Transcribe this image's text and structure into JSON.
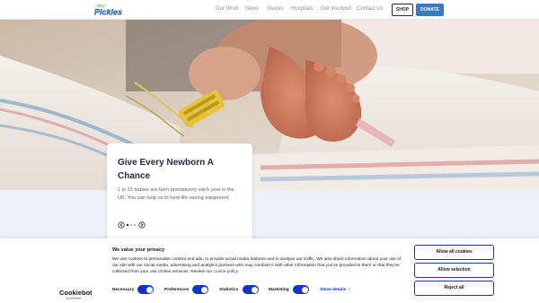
{
  "header": {
    "logo_text_top": "tiny",
    "logo_text_main": "Pickles",
    "nav": [
      {
        "label": "Our Work"
      },
      {
        "label": "News"
      },
      {
        "label": "Stories"
      },
      {
        "label": "Hospitals"
      },
      {
        "label": "Get Involved"
      },
      {
        "label": "Contact Us"
      }
    ],
    "shop_label": "SHOP",
    "donate_label": "DONATE"
  },
  "hero": {
    "card_title": "Give Every Newborn A Chance",
    "card_text": "1 in 13 babies are born prematurely each year in the UK. You can help us to fund life-saving equipment."
  },
  "cookie": {
    "title": "We value your privacy",
    "text": "We use cookies to personalise content and ads, to provide social media features and to analyse our traffic. We also share information about your use of our site with our social media, advertising and analytics partners who may combine it with other information that you've provided to them or that they've collected from your use of their services. Review our",
    "policy_link": "cookie policy",
    "policy_suffix": ".",
    "toggles": [
      {
        "label": "Necessary",
        "on": true
      },
      {
        "label": "Preferences",
        "on": true
      },
      {
        "label": "Statistics",
        "on": true
      },
      {
        "label": "Marketing",
        "on": true
      }
    ],
    "show_details": "Show details",
    "allow_all": "Allow all cookies",
    "allow_selection": "Allow selection",
    "reject_all": "Reject all",
    "logo_text": "Cookiebot",
    "logo_subtext": "by Usercentrics"
  },
  "colors": {
    "brand_blue": "#3a78c4",
    "cookie_blue": "#1032cf",
    "navy": "#1f2a44"
  }
}
